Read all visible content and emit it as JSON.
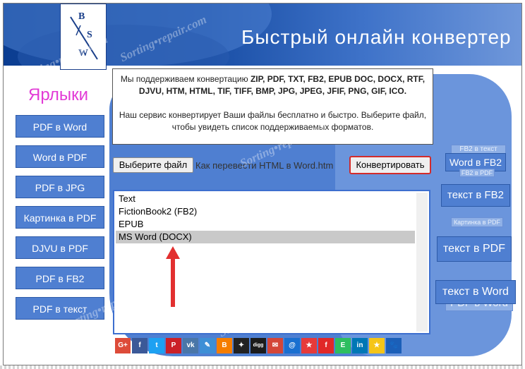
{
  "header": {
    "title": "Быстрый онлайн конвертер",
    "logo": {
      "top": "B",
      "middle": "S",
      "bottom": "W"
    }
  },
  "sidebar": {
    "title": "Ярлыки",
    "items": [
      {
        "label": "PDF в Word"
      },
      {
        "label": "Word в PDF"
      },
      {
        "label": "PDF в JPG"
      },
      {
        "label": "Картинка в PDF"
      },
      {
        "label": "DJVU в PDF"
      },
      {
        "label": "PDF в FB2"
      },
      {
        "label": "PDF в текст"
      }
    ]
  },
  "info": {
    "line1_prefix": "Мы поддерживаем конвертацию ",
    "line1_formats": "ZIP, PDF, TXT, FB2, EPUB DOC, DOCX, RTF,",
    "line2_formats": "DJVU, HTM, HTML, TIF, TIFF, BMP, JPG, JPEG, JFIF, PNG, GIF, ICO.",
    "line3": "Наш сервис конвертирует Ваши файлы бесплатно и быстро. Выберите файл,",
    "line4": "чтобы увидеть список поддерживаемых форматов."
  },
  "form": {
    "file_button": "Выберите файл",
    "file_name": "Как перевести HTML в Word.htm",
    "convert_button": "Конвертировать"
  },
  "formats": {
    "options": [
      "Text",
      "FictionBook2 (FB2)",
      "EPUB",
      "MS Word (DOCX)"
    ],
    "selected": "MS Word (DOCX)"
  },
  "right_buttons": {
    "fb2_to_text_small": "FB2 в текст",
    "word_to_fb2": "Word в FB2",
    "fb2_to_pdf_small": "FB2 в PDF",
    "text_to_fb2": "текст в FB2",
    "picture_to_pdf_small": "Картинка в PDF",
    "text_to_pdf": "текст в PDF",
    "text_to_word": "текст в Word",
    "pdf_to_word_ghost": "PDF в Word"
  },
  "social": {
    "icons": [
      {
        "name": "google-plus-icon",
        "glyph": "G+",
        "color": "#dd4b39"
      },
      {
        "name": "facebook-icon",
        "glyph": "f",
        "color": "#3b5998"
      },
      {
        "name": "twitter-icon",
        "glyph": "t",
        "color": "#1da1f2"
      },
      {
        "name": "pinterest-icon",
        "glyph": "P",
        "color": "#cb2027"
      },
      {
        "name": "vk-icon",
        "glyph": "vk",
        "color": "#4a76a8"
      },
      {
        "name": "clip-icon",
        "glyph": "✎",
        "color": "#3d8fd6"
      },
      {
        "name": "blogger-icon",
        "glyph": "B",
        "color": "#f57d00"
      },
      {
        "name": "myspace-icon",
        "glyph": "✦",
        "color": "#222222"
      },
      {
        "name": "digg-icon",
        "glyph": "digg",
        "color": "#1b1b1b"
      },
      {
        "name": "email-icon",
        "glyph": "✉",
        "color": "#d44638"
      },
      {
        "name": "mailru-icon",
        "glyph": "@",
        "color": "#1a6fd0"
      },
      {
        "name": "favorites-icon",
        "glyph": "★",
        "color": "#e63a3a"
      },
      {
        "name": "flipboard-icon",
        "glyph": "f",
        "color": "#e12828"
      },
      {
        "name": "evernote-icon",
        "glyph": "E",
        "color": "#2dbe60"
      },
      {
        "name": "linkedin-icon",
        "glyph": "in",
        "color": "#0077b5"
      },
      {
        "name": "star-icon",
        "glyph": "★",
        "color": "#f5c518"
      },
      {
        "name": "paw-icon",
        "glyph": "🐾",
        "color": "#1b5fb8"
      }
    ]
  },
  "colors": {
    "accent_blue": "#4f7fd1",
    "header_blue": "#0b3d91",
    "sidebar_title": "#e23ad6",
    "convert_border": "#d32b2b"
  }
}
